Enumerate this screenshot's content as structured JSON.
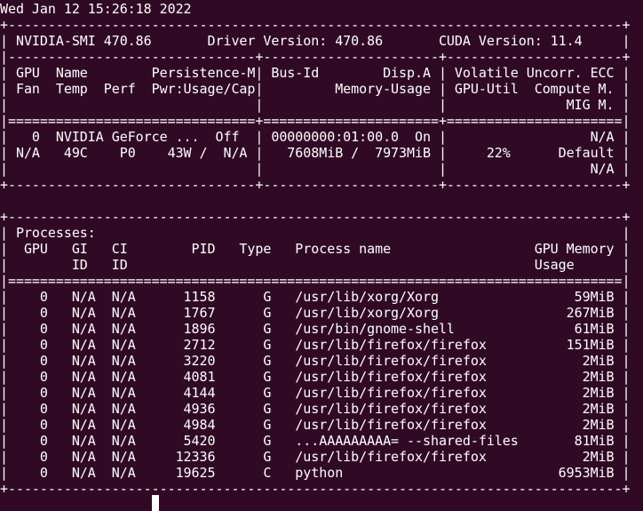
{
  "terminal": {
    "timestamp": "Wed Jan 12 15:26:18 2022",
    "gpu_table": {
      "top_border": "+-----------------------------------------------------------------------------+",
      "version_line": "| NVIDIA-SMI 470.86       Driver Version: 470.86       CUDA Version: 11.4     |",
      "sep_dash": "|-------------------------------+----------------------+----------------------+",
      "header_1": "| GPU  Name        Persistence-M| Bus-Id        Disp.A | Volatile Uncorr. ECC |",
      "header_2": "| Fan  Temp  Perf  Pwr:Usage/Cap|         Memory-Usage | GPU-Util  Compute M. |",
      "header_3": "|                               |                      |               MIG M. |",
      "sep_equal": "|===============================+======================+======================|",
      "row_1": "|   0  NVIDIA GeForce ...  Off  | 00000000:01:00.0  On |                  N/A |",
      "row_2": "| N/A   49C    P0    43W /  N/A |   7608MiB /  7973MiB |     22%      Default |",
      "row_3": "|                               |                      |                  N/A |",
      "bottom_border": "+-------------------------------+----------------------+----------------------+"
    },
    "proc_table": {
      "top_border": "+-----------------------------------------------------------------------------+",
      "title": "| Processes:                                                                  |",
      "header_1": "|  GPU   GI   CI        PID   Type   Process name                  GPU Memory |",
      "header_2": "|        ID   ID                                                   Usage      |",
      "sep_equal": "|=============================================================================|",
      "rows": [
        "|    0   N/A  N/A      1158      G   /usr/lib/xorg/Xorg                 59MiB |",
        "|    0   N/A  N/A      1767      G   /usr/lib/xorg/Xorg                267MiB |",
        "|    0   N/A  N/A      1896      G   /usr/bin/gnome-shell               61MiB |",
        "|    0   N/A  N/A      2712      G   /usr/lib/firefox/firefox          151MiB |",
        "|    0   N/A  N/A      3220      G   /usr/lib/firefox/firefox            2MiB |",
        "|    0   N/A  N/A      4081      G   /usr/lib/firefox/firefox            2MiB |",
        "|    0   N/A  N/A      4144      G   /usr/lib/firefox/firefox            2MiB |",
        "|    0   N/A  N/A      4936      G   /usr/lib/firefox/firefox            2MiB |",
        "|    0   N/A  N/A      4984      G   /usr/lib/firefox/firefox            2MiB |",
        "|    0   N/A  N/A      5420      G   ...AAAAAAAAA= --shared-files       81MiB |",
        "|    0   N/A  N/A     12336      G   /usr/lib/firefox/firefox            2MiB |",
        "|    0   N/A  N/A     19625      C   python                           6953MiB |"
      ],
      "bottom_border": "+-----------------------------------------------------------------------------+"
    }
  },
  "colors": {
    "background": "#300a24",
    "text": "#ffffff",
    "prompt": "#8ae234"
  }
}
